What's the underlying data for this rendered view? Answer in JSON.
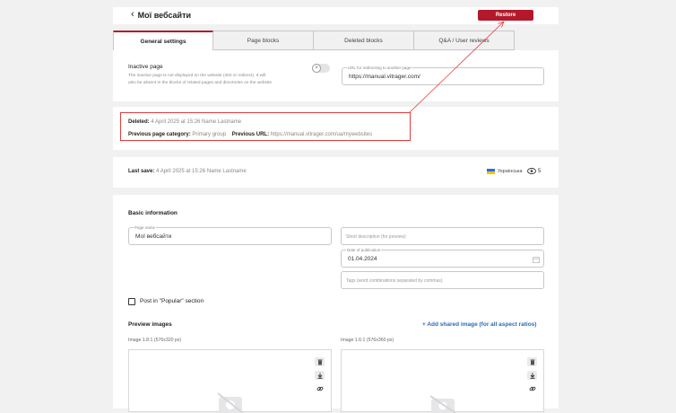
{
  "header": {
    "title": "Мої вебсайти",
    "restore_label": "Restore"
  },
  "tabs": [
    {
      "label": "General settings",
      "active": true
    },
    {
      "label": "Page blocks",
      "active": false
    },
    {
      "label": "Deleted blocks",
      "active": false
    },
    {
      "label": "Q&A / User reviews",
      "active": false
    }
  ],
  "settings": {
    "inactive_label": "Inactive page",
    "inactive_hint_1": "The inactive page is not displayed on the website (404 or redirect). It will",
    "inactive_hint_2": "also be absent in the blocks of related pages and directories on the website",
    "redirect_legend": "URL for redirecting to another page",
    "redirect_value": "https://manual.vitrager.com/"
  },
  "deleted_info": {
    "deleted_label": "Deleted:",
    "deleted_value": "4 April 2025 at 15:26  Name Lastname",
    "category_label": "Previous page category:",
    "category_value": "Primary group",
    "url_label": "Previous URL:",
    "url_value": "https://manual.vitrager.com/ua/mywebsites"
  },
  "last_save": {
    "label": "Last save:",
    "value": "4 April 2025 at 15:26  Name Lastname",
    "language": "Українська",
    "views": "5"
  },
  "basic": {
    "section_title": "Basic information",
    "page_name_legend": "Page name",
    "page_name_value": "Мої вебсайти",
    "short_desc_placeholder": "Short description (for preview)",
    "pub_date_legend": "Date of publication",
    "pub_date_value": "01.04.2024",
    "tags_placeholder": "Tags (word combinations separated by commas)",
    "popular_label": "Post in \"Popular\" section",
    "popular_checked": false
  },
  "preview": {
    "title": "Preview images",
    "add_shared": "+ Add shared image (for all aspect ratios)",
    "image1_label": "Image 1.8:1 (576x320 px)",
    "image2_label": "Image 1.6:1 (576x360 px)"
  },
  "colors": {
    "accent": "#b4182b",
    "link": "#2c6ab3",
    "highlight": "#e33a3a"
  }
}
